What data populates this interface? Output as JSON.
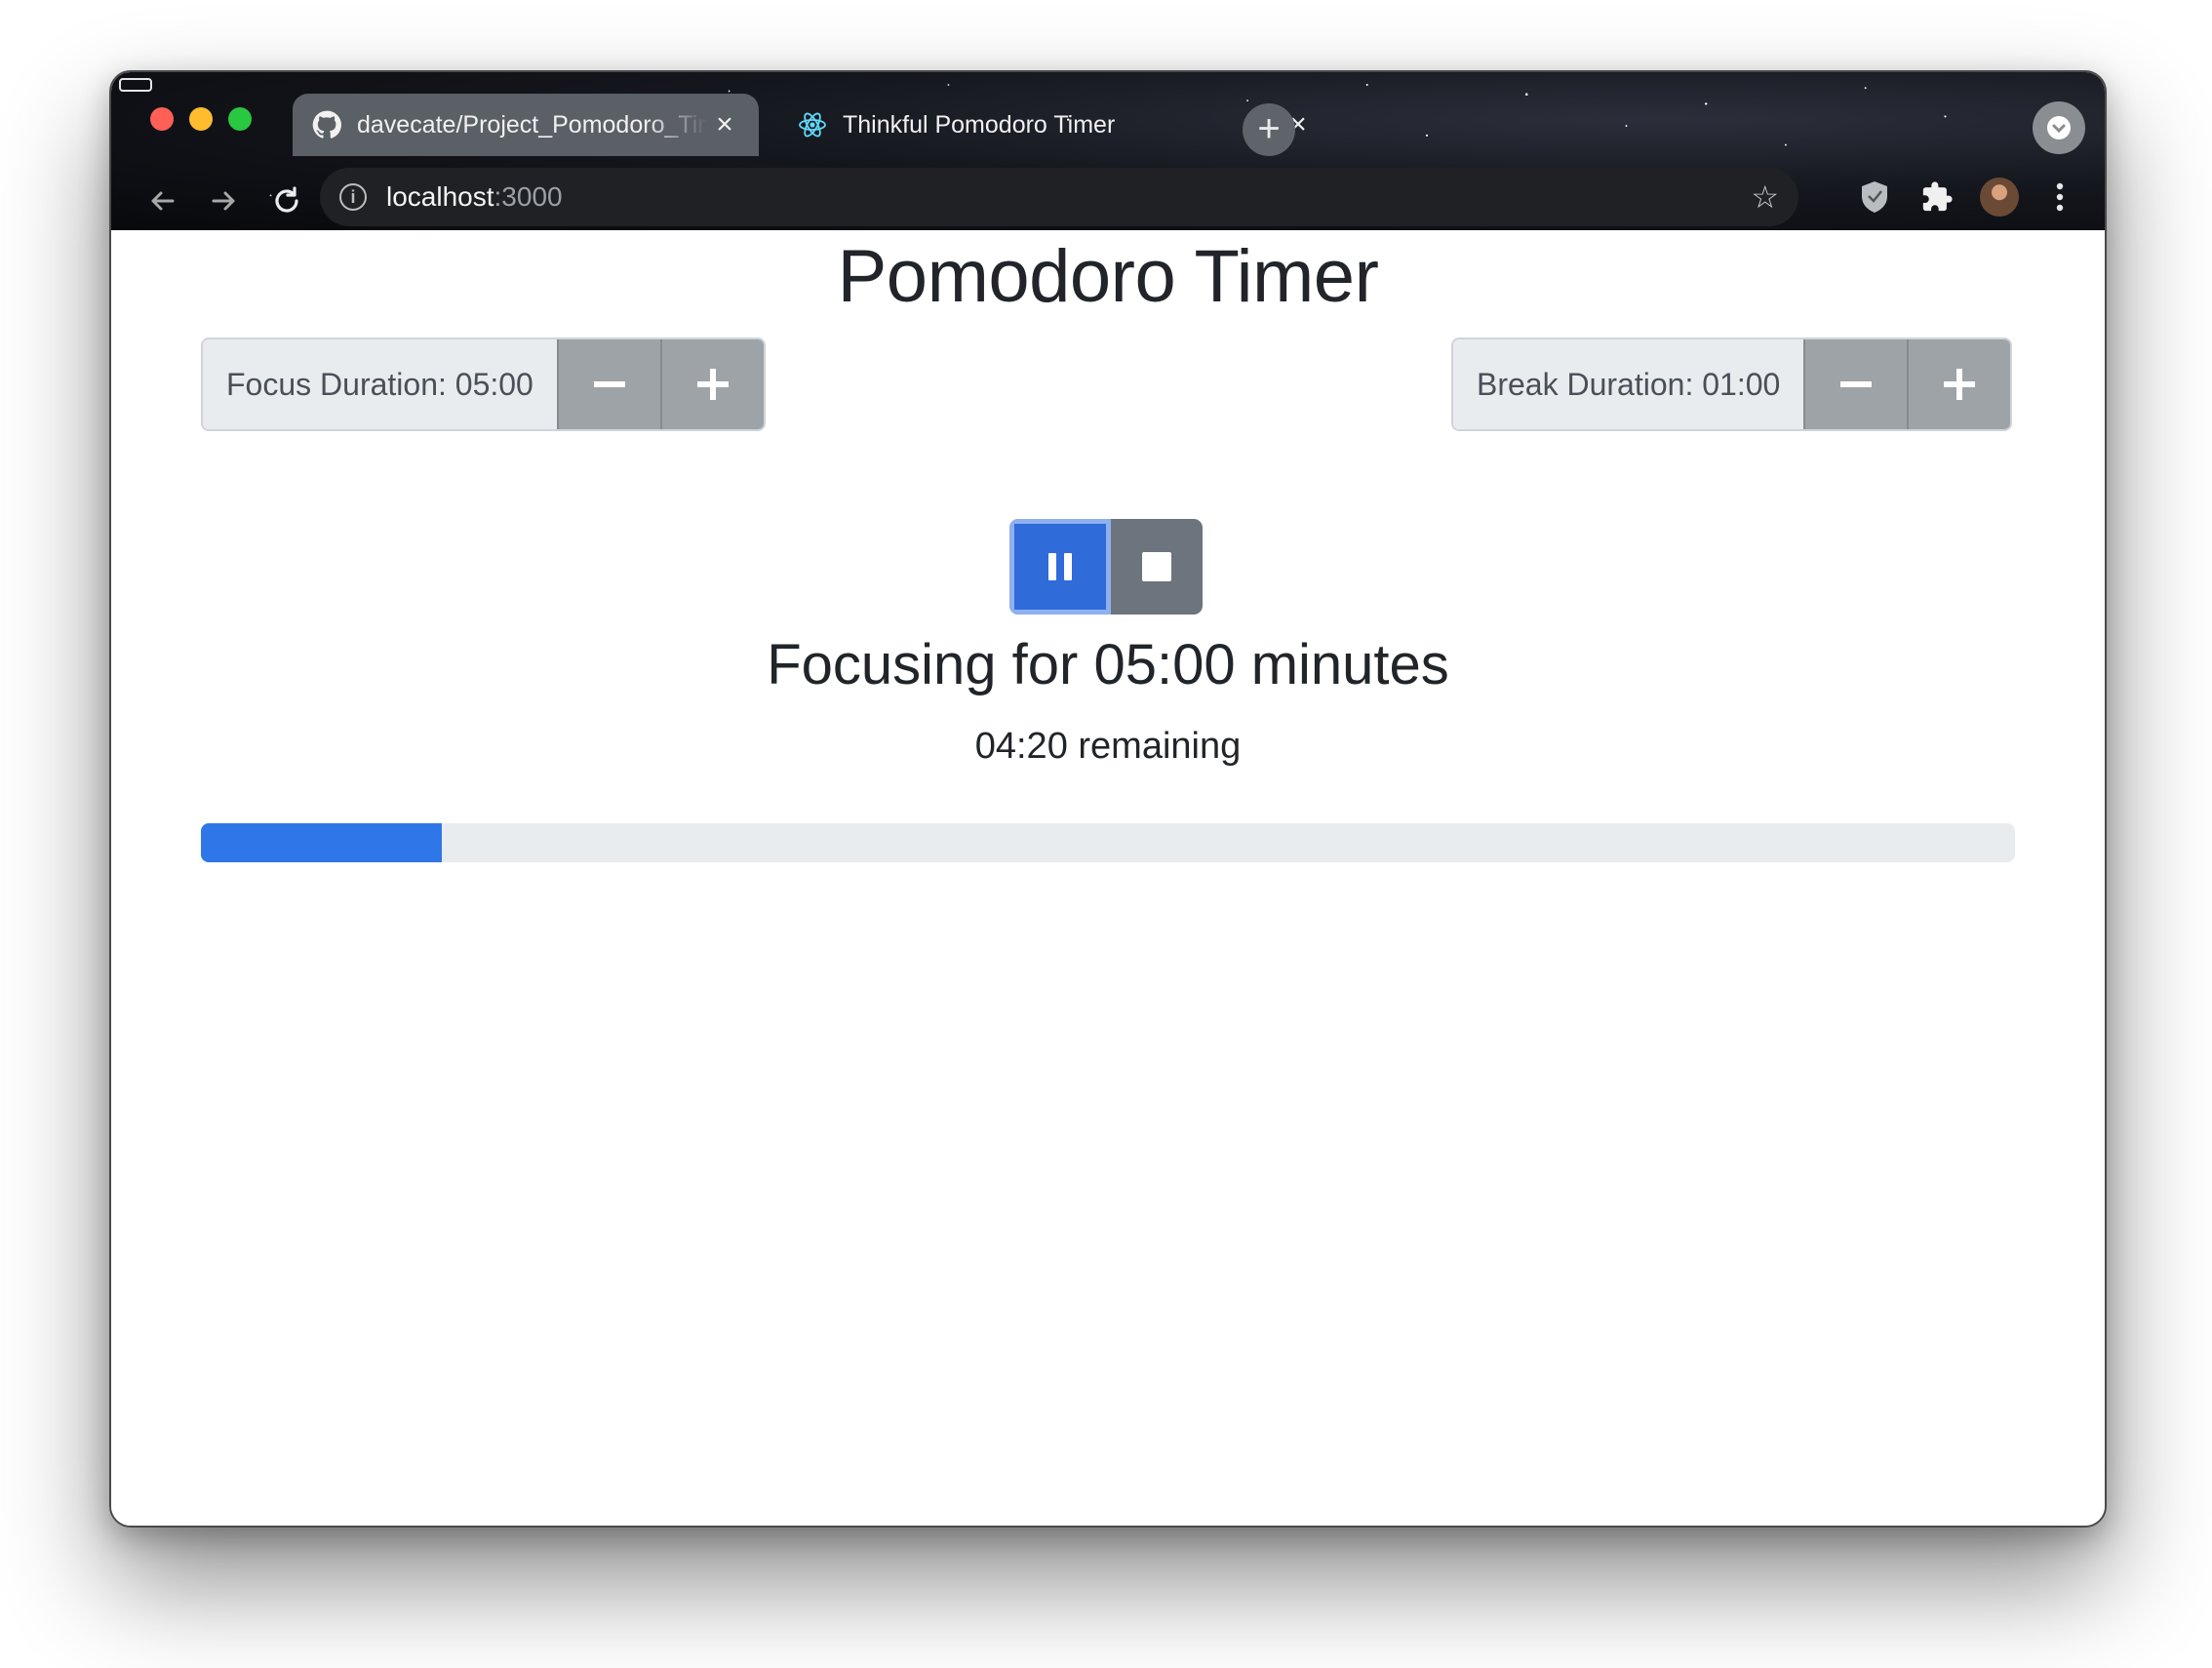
{
  "browser": {
    "tabs": [
      {
        "title": "davecate/Project_Pomodoro_Timer",
        "icon": "github-icon",
        "active": true
      },
      {
        "title": "Thinkful Pomodoro Timer",
        "icon": "react-icon",
        "active": false
      }
    ],
    "url": {
      "host": "localhost",
      "port": ":3000"
    }
  },
  "app": {
    "title": "Pomodoro Timer",
    "focus": {
      "label": "Focus Duration: 05:00"
    },
    "break": {
      "label": "Break Duration: 01:00"
    },
    "session": {
      "title": "Focusing for 05:00 minutes",
      "remaining": "04:20 remaining",
      "progress_percent": 13.3
    }
  },
  "colors": {
    "primary": "#2f6bd9",
    "secondary": "#6c757d",
    "progress_fill": "#2f76e9",
    "progress_track": "#e9ecef"
  }
}
